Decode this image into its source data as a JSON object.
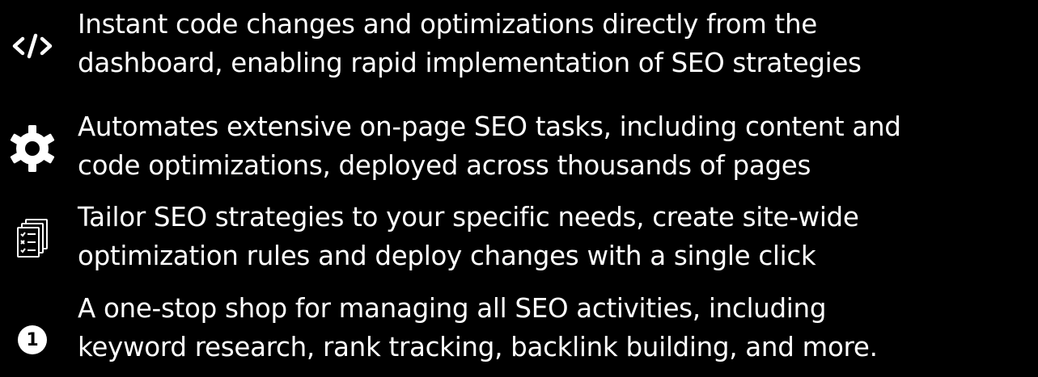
{
  "colors": {
    "background": "#000000",
    "text": "#ffffff"
  },
  "features": [
    {
      "icon": "code-icon",
      "lines": [
        "Instant code changes and optimizations directly from the",
        "dashboard, enabling rapid implementation of SEO strategies"
      ]
    },
    {
      "icon": "gear-icon",
      "lines": [
        "Automates extensive on-page SEO tasks, including content and",
        "code optimizations, deployed across thousands of pages"
      ]
    },
    {
      "icon": "checklist-documents-icon",
      "lines": [
        "Tailor SEO strategies to your specific needs, create site-wide",
        "optimization rules and deploy changes with a single click"
      ]
    },
    {
      "icon": "number-one-icon",
      "badge_text": "1",
      "lines": [
        "A one-stop shop for managing all SEO activities, including",
        "keyword research, rank tracking, backlink building, and more."
      ]
    }
  ]
}
